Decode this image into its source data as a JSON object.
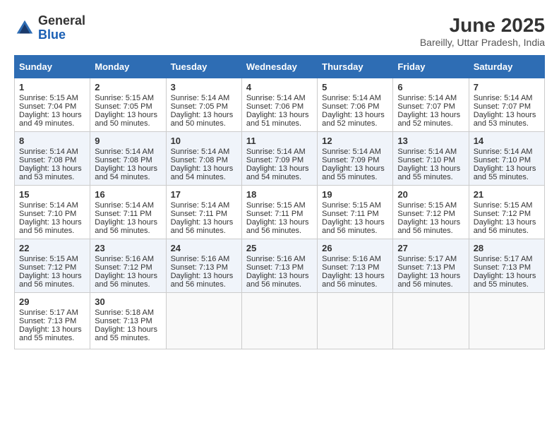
{
  "logo": {
    "general": "General",
    "blue": "Blue"
  },
  "title": {
    "month_year": "June 2025",
    "location": "Bareilly, Uttar Pradesh, India"
  },
  "days_of_week": [
    "Sunday",
    "Monday",
    "Tuesday",
    "Wednesday",
    "Thursday",
    "Friday",
    "Saturday"
  ],
  "weeks": [
    [
      {
        "day": "1",
        "sunrise": "5:15 AM",
        "sunset": "7:04 PM",
        "daylight": "13 hours and 49 minutes."
      },
      {
        "day": "2",
        "sunrise": "5:15 AM",
        "sunset": "7:05 PM",
        "daylight": "13 hours and 50 minutes."
      },
      {
        "day": "3",
        "sunrise": "5:14 AM",
        "sunset": "7:05 PM",
        "daylight": "13 hours and 50 minutes."
      },
      {
        "day": "4",
        "sunrise": "5:14 AM",
        "sunset": "7:06 PM",
        "daylight": "13 hours and 51 minutes."
      },
      {
        "day": "5",
        "sunrise": "5:14 AM",
        "sunset": "7:06 PM",
        "daylight": "13 hours and 52 minutes."
      },
      {
        "day": "6",
        "sunrise": "5:14 AM",
        "sunset": "7:07 PM",
        "daylight": "13 hours and 52 minutes."
      },
      {
        "day": "7",
        "sunrise": "5:14 AM",
        "sunset": "7:07 PM",
        "daylight": "13 hours and 53 minutes."
      }
    ],
    [
      {
        "day": "8",
        "sunrise": "5:14 AM",
        "sunset": "7:08 PM",
        "daylight": "13 hours and 53 minutes."
      },
      {
        "day": "9",
        "sunrise": "5:14 AM",
        "sunset": "7:08 PM",
        "daylight": "13 hours and 54 minutes."
      },
      {
        "day": "10",
        "sunrise": "5:14 AM",
        "sunset": "7:08 PM",
        "daylight": "13 hours and 54 minutes."
      },
      {
        "day": "11",
        "sunrise": "5:14 AM",
        "sunset": "7:09 PM",
        "daylight": "13 hours and 54 minutes."
      },
      {
        "day": "12",
        "sunrise": "5:14 AM",
        "sunset": "7:09 PM",
        "daylight": "13 hours and 55 minutes."
      },
      {
        "day": "13",
        "sunrise": "5:14 AM",
        "sunset": "7:10 PM",
        "daylight": "13 hours and 55 minutes."
      },
      {
        "day": "14",
        "sunrise": "5:14 AM",
        "sunset": "7:10 PM",
        "daylight": "13 hours and 55 minutes."
      }
    ],
    [
      {
        "day": "15",
        "sunrise": "5:14 AM",
        "sunset": "7:10 PM",
        "daylight": "13 hours and 56 minutes."
      },
      {
        "day": "16",
        "sunrise": "5:14 AM",
        "sunset": "7:11 PM",
        "daylight": "13 hours and 56 minutes."
      },
      {
        "day": "17",
        "sunrise": "5:14 AM",
        "sunset": "7:11 PM",
        "daylight": "13 hours and 56 minutes."
      },
      {
        "day": "18",
        "sunrise": "5:15 AM",
        "sunset": "7:11 PM",
        "daylight": "13 hours and 56 minutes."
      },
      {
        "day": "19",
        "sunrise": "5:15 AM",
        "sunset": "7:11 PM",
        "daylight": "13 hours and 56 minutes."
      },
      {
        "day": "20",
        "sunrise": "5:15 AM",
        "sunset": "7:12 PM",
        "daylight": "13 hours and 56 minutes."
      },
      {
        "day": "21",
        "sunrise": "5:15 AM",
        "sunset": "7:12 PM",
        "daylight": "13 hours and 56 minutes."
      }
    ],
    [
      {
        "day": "22",
        "sunrise": "5:15 AM",
        "sunset": "7:12 PM",
        "daylight": "13 hours and 56 minutes."
      },
      {
        "day": "23",
        "sunrise": "5:16 AM",
        "sunset": "7:12 PM",
        "daylight": "13 hours and 56 minutes."
      },
      {
        "day": "24",
        "sunrise": "5:16 AM",
        "sunset": "7:13 PM",
        "daylight": "13 hours and 56 minutes."
      },
      {
        "day": "25",
        "sunrise": "5:16 AM",
        "sunset": "7:13 PM",
        "daylight": "13 hours and 56 minutes."
      },
      {
        "day": "26",
        "sunrise": "5:16 AM",
        "sunset": "7:13 PM",
        "daylight": "13 hours and 56 minutes."
      },
      {
        "day": "27",
        "sunrise": "5:17 AM",
        "sunset": "7:13 PM",
        "daylight": "13 hours and 56 minutes."
      },
      {
        "day": "28",
        "sunrise": "5:17 AM",
        "sunset": "7:13 PM",
        "daylight": "13 hours and 55 minutes."
      }
    ],
    [
      {
        "day": "29",
        "sunrise": "5:17 AM",
        "sunset": "7:13 PM",
        "daylight": "13 hours and 55 minutes."
      },
      {
        "day": "30",
        "sunrise": "5:18 AM",
        "sunset": "7:13 PM",
        "daylight": "13 hours and 55 minutes."
      },
      null,
      null,
      null,
      null,
      null
    ]
  ],
  "labels": {
    "sunrise": "Sunrise:",
    "sunset": "Sunset:",
    "daylight": "Daylight:"
  }
}
